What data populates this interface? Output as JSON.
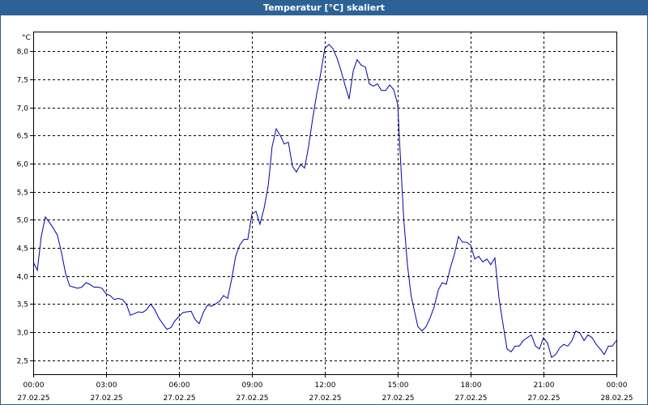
{
  "window": {
    "title": "Temperatur [°C] skaliert"
  },
  "chart_data": {
    "type": "line",
    "title": "Temperatur [°C] skaliert",
    "xlabel": "",
    "ylabel": "°C",
    "xlim_hours": [
      0,
      24
    ],
    "ylim": [
      2.25,
      8.35
    ],
    "grid": true,
    "line_color": "#0000aa",
    "y_ticks": [
      "2,5",
      "3,0",
      "3,5",
      "4,0",
      "4,5",
      "5,0",
      "5,5",
      "6,0",
      "6,5",
      "7,0",
      "7,5",
      "8,0"
    ],
    "y_tick_values": [
      2.5,
      3.0,
      3.5,
      4.0,
      4.5,
      5.0,
      5.5,
      6.0,
      6.5,
      7.0,
      7.5,
      8.0
    ],
    "x_ticks": [
      {
        "hour": 0,
        "time": "00:00",
        "date": "27.02.25"
      },
      {
        "hour": 3,
        "time": "03:00",
        "date": "27.02.25"
      },
      {
        "hour": 6,
        "time": "06:00",
        "date": "27.02.25"
      },
      {
        "hour": 9,
        "time": "09:00",
        "date": "27.02.25"
      },
      {
        "hour": 12,
        "time": "12:00",
        "date": "27.02.25"
      },
      {
        "hour": 15,
        "time": "15:00",
        "date": "27.02.25"
      },
      {
        "hour": 18,
        "time": "18:00",
        "date": "27.02.25"
      },
      {
        "hour": 21,
        "time": "21:00",
        "date": "27.02.25"
      },
      {
        "hour": 24,
        "time": "00:00",
        "date": "28.02.25"
      }
    ],
    "series": [
      {
        "values": [
          [
            0.0,
            4.25
          ],
          [
            0.17,
            4.1
          ],
          [
            0.33,
            4.7
          ],
          [
            0.5,
            5.05
          ],
          [
            0.67,
            4.95
          ],
          [
            0.83,
            4.85
          ],
          [
            1.0,
            4.72
          ],
          [
            1.17,
            4.4
          ],
          [
            1.33,
            4.05
          ],
          [
            1.5,
            3.82
          ],
          [
            1.67,
            3.8
          ],
          [
            1.83,
            3.78
          ],
          [
            2.0,
            3.8
          ],
          [
            2.17,
            3.88
          ],
          [
            2.33,
            3.85
          ],
          [
            2.5,
            3.8
          ],
          [
            2.67,
            3.8
          ],
          [
            2.83,
            3.78
          ],
          [
            3.0,
            3.68
          ],
          [
            3.17,
            3.65
          ],
          [
            3.33,
            3.58
          ],
          [
            3.5,
            3.6
          ],
          [
            3.67,
            3.58
          ],
          [
            3.83,
            3.5
          ],
          [
            4.0,
            3.3
          ],
          [
            4.17,
            3.33
          ],
          [
            4.33,
            3.36
          ],
          [
            4.5,
            3.35
          ],
          [
            4.67,
            3.4
          ],
          [
            4.83,
            3.5
          ],
          [
            5.0,
            3.4
          ],
          [
            5.17,
            3.25
          ],
          [
            5.33,
            3.15
          ],
          [
            5.5,
            3.05
          ],
          [
            5.67,
            3.08
          ],
          [
            5.83,
            3.2
          ],
          [
            6.0,
            3.28
          ],
          [
            6.17,
            3.35
          ],
          [
            6.33,
            3.36
          ],
          [
            6.5,
            3.37
          ],
          [
            6.67,
            3.22
          ],
          [
            6.83,
            3.15
          ],
          [
            7.0,
            3.35
          ],
          [
            7.17,
            3.48
          ],
          [
            7.33,
            3.46
          ],
          [
            7.5,
            3.5
          ],
          [
            7.67,
            3.55
          ],
          [
            7.83,
            3.65
          ],
          [
            8.0,
            3.6
          ],
          [
            8.17,
            3.95
          ],
          [
            8.33,
            4.35
          ],
          [
            8.5,
            4.55
          ],
          [
            8.67,
            4.65
          ],
          [
            8.83,
            4.65
          ],
          [
            9.0,
            5.1
          ],
          [
            9.17,
            5.15
          ],
          [
            9.33,
            4.92
          ],
          [
            9.5,
            5.2
          ],
          [
            9.67,
            5.6
          ],
          [
            9.83,
            6.3
          ],
          [
            10.0,
            6.62
          ],
          [
            10.17,
            6.5
          ],
          [
            10.33,
            6.35
          ],
          [
            10.5,
            6.38
          ],
          [
            10.67,
            5.95
          ],
          [
            10.83,
            5.85
          ],
          [
            11.0,
            5.98
          ],
          [
            11.17,
            5.92
          ],
          [
            11.33,
            6.3
          ],
          [
            11.5,
            6.8
          ],
          [
            11.67,
            7.25
          ],
          [
            11.83,
            7.6
          ],
          [
            12.0,
            8.05
          ],
          [
            12.17,
            8.12
          ],
          [
            12.33,
            8.05
          ],
          [
            12.5,
            7.88
          ],
          [
            12.67,
            7.65
          ],
          [
            12.83,
            7.4
          ],
          [
            13.0,
            7.15
          ],
          [
            13.17,
            7.65
          ],
          [
            13.33,
            7.85
          ],
          [
            13.5,
            7.75
          ],
          [
            13.67,
            7.72
          ],
          [
            13.83,
            7.42
          ],
          [
            14.0,
            7.38
          ],
          [
            14.17,
            7.42
          ],
          [
            14.33,
            7.3
          ],
          [
            14.5,
            7.3
          ],
          [
            14.67,
            7.4
          ],
          [
            14.83,
            7.32
          ],
          [
            15.0,
            7.05
          ],
          [
            15.1,
            6.2
          ],
          [
            15.25,
            5.0
          ],
          [
            15.4,
            4.2
          ],
          [
            15.55,
            3.65
          ],
          [
            15.7,
            3.35
          ],
          [
            15.83,
            3.1
          ],
          [
            16.0,
            3.02
          ],
          [
            16.17,
            3.1
          ],
          [
            16.33,
            3.25
          ],
          [
            16.5,
            3.45
          ],
          [
            16.67,
            3.75
          ],
          [
            16.83,
            3.88
          ],
          [
            17.0,
            3.85
          ],
          [
            17.17,
            4.15
          ],
          [
            17.33,
            4.38
          ],
          [
            17.5,
            4.7
          ],
          [
            17.67,
            4.6
          ],
          [
            17.83,
            4.6
          ],
          [
            18.0,
            4.55
          ],
          [
            18.17,
            4.3
          ],
          [
            18.33,
            4.35
          ],
          [
            18.5,
            4.25
          ],
          [
            18.67,
            4.3
          ],
          [
            18.83,
            4.2
          ],
          [
            19.0,
            4.32
          ],
          [
            19.17,
            3.6
          ],
          [
            19.33,
            3.15
          ],
          [
            19.5,
            2.7
          ],
          [
            19.67,
            2.65
          ],
          [
            19.83,
            2.75
          ],
          [
            20.0,
            2.75
          ],
          [
            20.17,
            2.85
          ],
          [
            20.33,
            2.9
          ],
          [
            20.5,
            2.95
          ],
          [
            20.67,
            2.75
          ],
          [
            20.83,
            2.7
          ],
          [
            21.0,
            2.9
          ],
          [
            21.17,
            2.8
          ],
          [
            21.33,
            2.55
          ],
          [
            21.5,
            2.6
          ],
          [
            21.67,
            2.72
          ],
          [
            21.83,
            2.78
          ],
          [
            22.0,
            2.75
          ],
          [
            22.17,
            2.85
          ],
          [
            22.33,
            3.02
          ],
          [
            22.5,
            2.98
          ],
          [
            22.67,
            2.85
          ],
          [
            22.83,
            2.95
          ],
          [
            23.0,
            2.9
          ],
          [
            23.17,
            2.78
          ],
          [
            23.33,
            2.7
          ],
          [
            23.5,
            2.6
          ],
          [
            23.67,
            2.75
          ],
          [
            23.83,
            2.75
          ],
          [
            24.0,
            2.85
          ]
        ]
      }
    ]
  }
}
